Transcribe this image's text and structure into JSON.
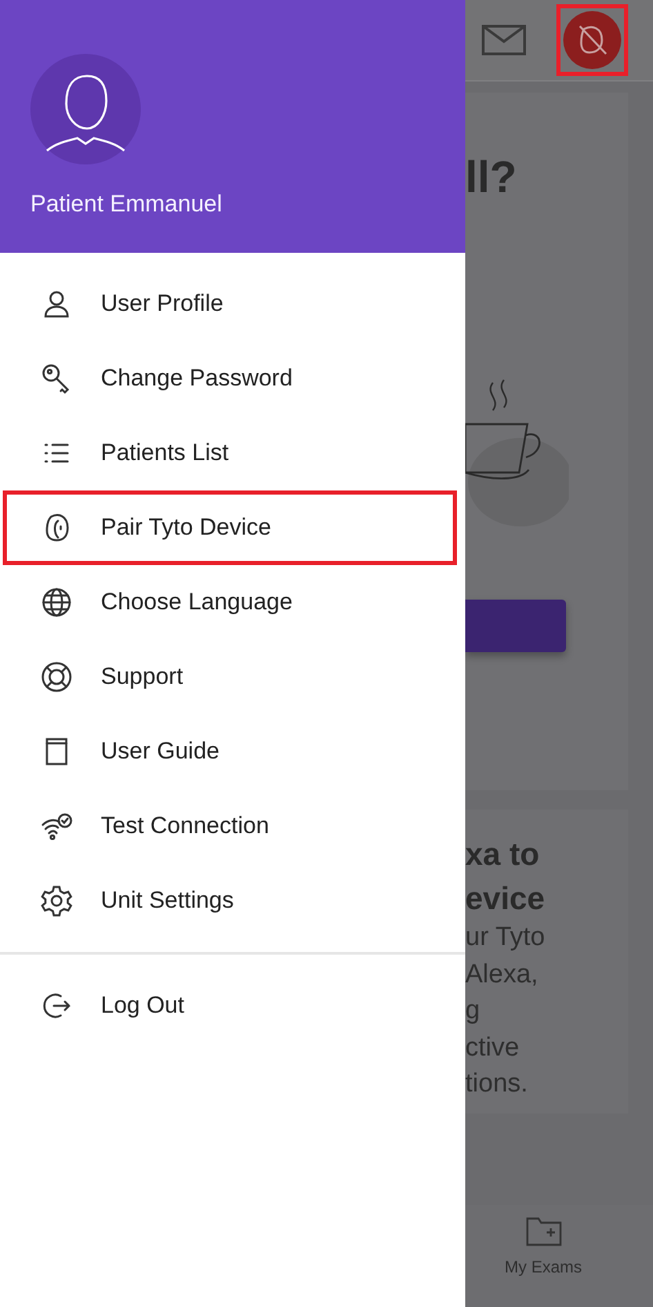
{
  "drawer": {
    "user_name": "Patient Emmanuel",
    "items": [
      {
        "label": "User Profile",
        "kind": "user",
        "highlighted": false
      },
      {
        "label": "Change Password",
        "kind": "key",
        "highlighted": false
      },
      {
        "label": "Patients List",
        "kind": "list",
        "highlighted": false
      },
      {
        "label": "Pair Tyto Device",
        "kind": "device",
        "highlighted": true
      },
      {
        "label": "Choose Language",
        "kind": "globe",
        "highlighted": false
      },
      {
        "label": "Support",
        "kind": "lifebuoy",
        "highlighted": false
      },
      {
        "label": "User Guide",
        "kind": "book",
        "highlighted": false
      },
      {
        "label": "Test Connection",
        "kind": "wifi",
        "highlighted": false
      },
      {
        "label": "Unit Settings",
        "kind": "gear",
        "highlighted": false
      }
    ],
    "footer_items": [
      {
        "label": "Log Out",
        "kind": "logout",
        "highlighted": false
      }
    ]
  },
  "background": {
    "top_bar": {
      "device_highlighted": true
    },
    "card_1": {
      "title": "ll?"
    },
    "card_2": {
      "title_lines": [
        "xa to",
        "evice"
      ],
      "body_lines": [
        "ur Tyto",
        "Alexa,",
        "g",
        "ctive",
        "tions."
      ]
    },
    "bottom_nav": [
      {
        "label": "My Exams"
      }
    ]
  }
}
